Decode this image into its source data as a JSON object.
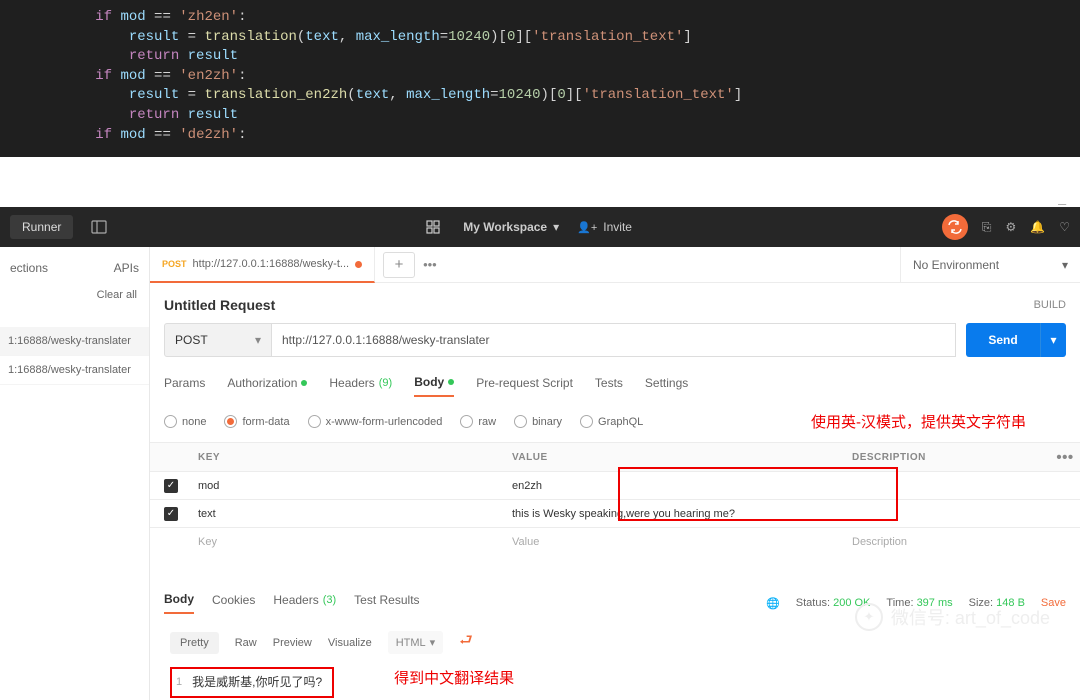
{
  "code": {
    "lines": [
      {
        "indent": 8,
        "tokens": [
          {
            "t": "if ",
            "c": "k-if"
          },
          {
            "t": "mod ",
            "c": "k-var"
          },
          {
            "t": "== ",
            "c": "k-eq"
          },
          {
            "t": "'zh2en'",
            "c": "k-str"
          },
          {
            "t": ":",
            "c": "k-eq"
          }
        ]
      },
      {
        "indent": 12,
        "tokens": [
          {
            "t": "result ",
            "c": "k-var"
          },
          {
            "t": "= ",
            "c": "k-eq"
          },
          {
            "t": "translation",
            "c": "k-fn"
          },
          {
            "t": "(",
            "c": "k-eq"
          },
          {
            "t": "text",
            "c": "k-var"
          },
          {
            "t": ", ",
            "c": "k-eq"
          },
          {
            "t": "max_length",
            "c": "k-var"
          },
          {
            "t": "=",
            "c": "k-eq"
          },
          {
            "t": "10240",
            "c": "k-num"
          },
          {
            "t": ")[",
            "c": "k-eq"
          },
          {
            "t": "0",
            "c": "k-num"
          },
          {
            "t": "][",
            "c": "k-eq"
          },
          {
            "t": "'translation_text'",
            "c": "k-str"
          },
          {
            "t": "]",
            "c": "k-eq"
          }
        ]
      },
      {
        "indent": 12,
        "tokens": [
          {
            "t": "return ",
            "c": "k-ret"
          },
          {
            "t": "result",
            "c": "k-var"
          }
        ]
      },
      {
        "indent": 8,
        "tokens": [
          {
            "t": "if ",
            "c": "k-if"
          },
          {
            "t": "mod ",
            "c": "k-var"
          },
          {
            "t": "== ",
            "c": "k-eq"
          },
          {
            "t": "'en2zh'",
            "c": "k-str"
          },
          {
            "t": ":",
            "c": "k-eq"
          }
        ]
      },
      {
        "indent": 12,
        "tokens": [
          {
            "t": "result ",
            "c": "k-var"
          },
          {
            "t": "= ",
            "c": "k-eq"
          },
          {
            "t": "translation_en2zh",
            "c": "k-fn"
          },
          {
            "t": "(",
            "c": "k-eq"
          },
          {
            "t": "text",
            "c": "k-var"
          },
          {
            "t": ", ",
            "c": "k-eq"
          },
          {
            "t": "max_length",
            "c": "k-var"
          },
          {
            "t": "=",
            "c": "k-eq"
          },
          {
            "t": "10240",
            "c": "k-num"
          },
          {
            "t": ")[",
            "c": "k-eq"
          },
          {
            "t": "0",
            "c": "k-num"
          },
          {
            "t": "][",
            "c": "k-eq"
          },
          {
            "t": "'translation_text'",
            "c": "k-str"
          },
          {
            "t": "]",
            "c": "k-eq"
          }
        ]
      },
      {
        "indent": 12,
        "tokens": [
          {
            "t": "return ",
            "c": "k-ret"
          },
          {
            "t": "result",
            "c": "k-var"
          }
        ]
      },
      {
        "indent": 8,
        "tokens": [
          {
            "t": "if ",
            "c": "k-if"
          },
          {
            "t": "mod ",
            "c": "k-var"
          },
          {
            "t": "== ",
            "c": "k-eq"
          },
          {
            "t": "'de2zh'",
            "c": "k-str"
          },
          {
            "t": ":",
            "c": "k-eq"
          }
        ]
      }
    ]
  },
  "topbar": {
    "runner": "Runner",
    "workspace": "My Workspace",
    "invite": "Invite"
  },
  "sidebar": {
    "tab1": "ections",
    "tab2": "APIs",
    "clear": "Clear all",
    "history": [
      "1:16888/wesky-translater",
      "1:16888/wesky-translater"
    ]
  },
  "request": {
    "tab_method": "POST",
    "tab_url": "http://127.0.0.1:16888/wesky-t...",
    "env": "No Environment",
    "title": "Untitled Request",
    "build": "BUILD",
    "method": "POST",
    "url": "http://127.0.0.1:16888/wesky-translater",
    "send": "Send",
    "tabs": {
      "params": "Params",
      "auth": "Authorization",
      "headers": "Headers",
      "headers_count": "(9)",
      "body": "Body",
      "prerequest": "Pre-request Script",
      "tests": "Tests",
      "settings": "Settings"
    },
    "body_types": {
      "none": "none",
      "formdata": "form-data",
      "xwww": "x-www-form-urlencoded",
      "raw": "raw",
      "binary": "binary",
      "graphql": "GraphQL"
    },
    "annotation1": "使用英-汉模式，提供英文字符串"
  },
  "table": {
    "h_key": "KEY",
    "h_value": "VALUE",
    "h_desc": "DESCRIPTION",
    "rows": [
      {
        "key": "mod",
        "value": "en2zh",
        "desc": ""
      },
      {
        "key": "text",
        "value": "this is Wesky speaking,were you hearing me?",
        "desc": ""
      }
    ],
    "placeholder_key": "Key",
    "placeholder_value": "Value",
    "placeholder_desc": "Description"
  },
  "response": {
    "tabs": {
      "body": "Body",
      "cookies": "Cookies",
      "headers": "Headers",
      "headers_count": "(3)",
      "tests": "Test Results"
    },
    "status_label": "Status:",
    "status_value": "200 OK",
    "time_label": "Time:",
    "time_value": "397 ms",
    "size_label": "Size:",
    "size_value": "148 B",
    "save": "Save",
    "fmt": {
      "pretty": "Pretty",
      "raw": "Raw",
      "preview": "Preview",
      "visualize": "Visualize",
      "type": "HTML"
    },
    "body_line1": "1",
    "body_text": "我是威斯基,你听见了吗?",
    "annotation2": "得到中文翻译结果"
  },
  "watermark": "微信号: art_of_code"
}
